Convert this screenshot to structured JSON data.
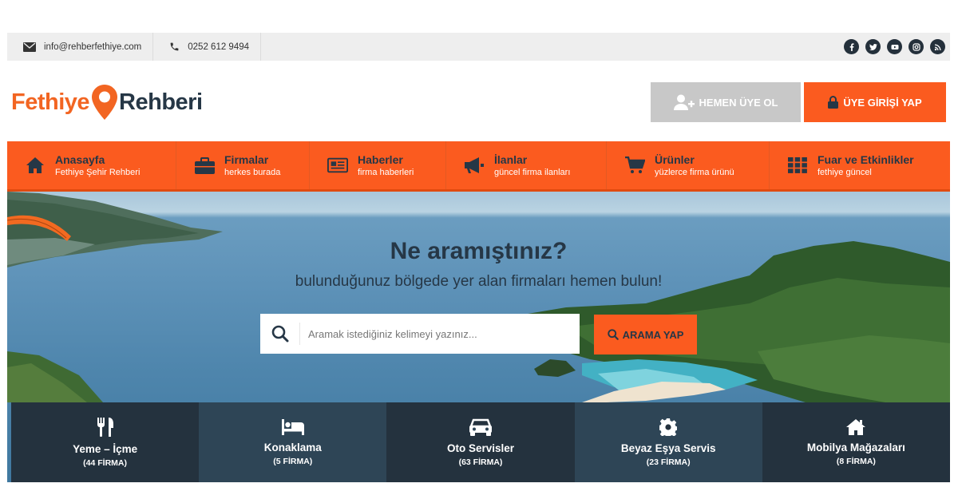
{
  "topbar": {
    "email": "info@rehberfethiye.com",
    "phone": "0252 612 9494",
    "social": [
      "facebook-icon",
      "twitter-icon",
      "youtube-icon",
      "instagram-icon",
      "rss-icon"
    ]
  },
  "header": {
    "logo_part1": "Fethiye",
    "logo_part2": "Rehberi",
    "register_label": "HEMEN ÜYE OL",
    "login_label": "ÜYE GİRİŞİ YAP"
  },
  "colors": {
    "accent": "#fb5b1f",
    "dark": "#263746",
    "muted": "#c8c8c8"
  },
  "nav": [
    {
      "title": "Anasayfa",
      "sub": "Fethiye Şehir Rehberi",
      "icon": "home-icon"
    },
    {
      "title": "Firmalar",
      "sub": "herkes burada",
      "icon": "briefcase-icon"
    },
    {
      "title": "Haberler",
      "sub": "firma haberleri",
      "icon": "newspaper-icon"
    },
    {
      "title": "İlanlar",
      "sub": "güncel firma ilanları",
      "icon": "megaphone-icon"
    },
    {
      "title": "Ürünler",
      "sub": "yüzlerce firma ürünü",
      "icon": "cart-icon"
    },
    {
      "title": "Fuar ve Etkinlikler",
      "sub": "fethiye güncel",
      "icon": "grid-icon"
    }
  ],
  "hero": {
    "title": "Ne aramıştınız?",
    "subtitle": "bulunduğunuz bölgede yer alan firmaları hemen bulun!",
    "search_placeholder": "Aramak istediğiniz kelimeyi yazınız...",
    "search_button": "ARAMA YAP"
  },
  "categories": [
    {
      "title": "Yeme – İçme",
      "count": "(44 FİRMA)",
      "icon": "utensils-icon"
    },
    {
      "title": "Konaklama",
      "count": "(5 FİRMA)",
      "icon": "bed-icon"
    },
    {
      "title": "Oto Servisler",
      "count": "(63 FİRMA)",
      "icon": "car-icon"
    },
    {
      "title": "Beyaz Eşya Servis",
      "count": "(23 FİRMA)",
      "icon": "gear-icon"
    },
    {
      "title": "Mobilya Mağazaları",
      "count": "(8 FİRMA)",
      "icon": "house-icon"
    }
  ]
}
